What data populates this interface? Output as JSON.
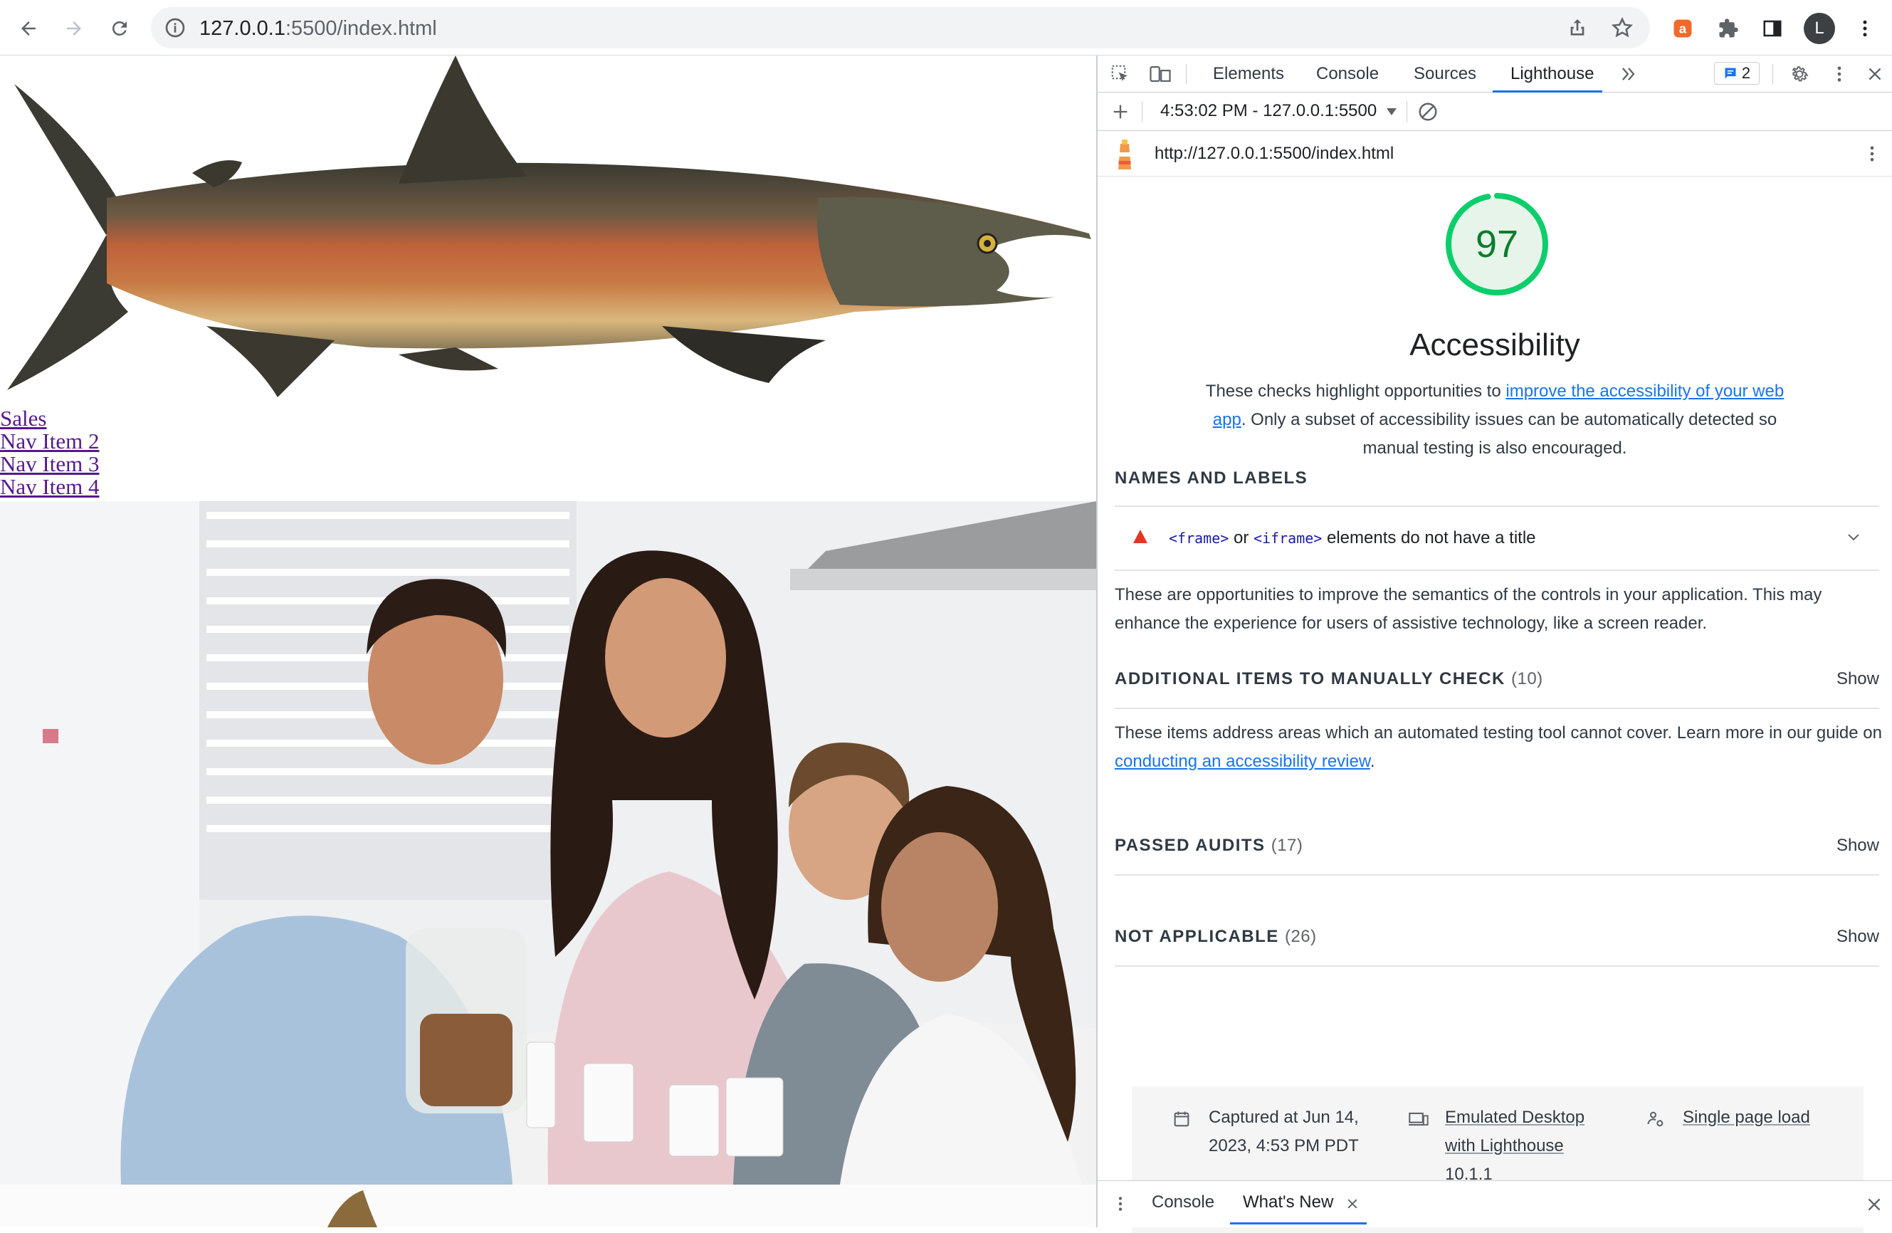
{
  "browser": {
    "url_host": "127.0.0.1",
    "url_rest": ":5500/index.html",
    "profile_initial": "L"
  },
  "page": {
    "nav_links": [
      "Sales",
      "Nav Item 2",
      "Nav Item 3",
      "Nav Item 4"
    ]
  },
  "devtools": {
    "tabs": [
      "Elements",
      "Console",
      "Sources",
      "Lighthouse"
    ],
    "active_tab": "Lighthouse",
    "issues_count": "2",
    "report_select": "4:53:02 PM - 127.0.0.1:5500",
    "report_url": "http://127.0.0.1:5500/index.html",
    "score": "97",
    "score_fraction": 0.97,
    "category_title": "Accessibility",
    "category_desc_before": "These checks highlight opportunities to ",
    "category_desc_link": "improve the accessibility of your web app",
    "category_desc_after": ". Only a subset of accessibility issues can be automatically detected so manual testing is also encouraged.",
    "groups": {
      "names_labels": {
        "title": "NAMES AND LABELS",
        "audit_code_1": "<frame>",
        "audit_or": " or ",
        "audit_code_2": "<iframe>",
        "audit_text": " elements do not have a title",
        "description": "These are opportunities to improve the semantics of the controls in your application. This may enhance the experience for users of assistive technology, like a screen reader."
      },
      "manual": {
        "title": "ADDITIONAL ITEMS TO MANUALLY CHECK",
        "count": "(10)",
        "show": "Show",
        "desc_before": "These items address areas which an automated testing tool cannot cover. Learn more in our guide on ",
        "desc_link": "conducting an accessibility review",
        "desc_after": "."
      },
      "passed": {
        "title": "PASSED AUDITS",
        "count": "(17)",
        "show": "Show"
      },
      "not_applicable": {
        "title": "NOT APPLICABLE",
        "count": "(26)",
        "show": "Show"
      }
    },
    "footer": {
      "captured": "Captured at Jun 14, 2023, 4:53 PM PDT",
      "emulation": "Emulated Desktop with Lighthouse 10.1.1",
      "mode": "Single page load"
    },
    "drawer": {
      "tabs": [
        "Console",
        "What's New"
      ],
      "active_tab": "What's New"
    }
  },
  "colors": {
    "score_green": "#0cce6b",
    "score_text": "#0c7d2b",
    "link_blue": "#1a73e8",
    "visited_link": "#551a8b",
    "fail_red": "#eb3323"
  }
}
